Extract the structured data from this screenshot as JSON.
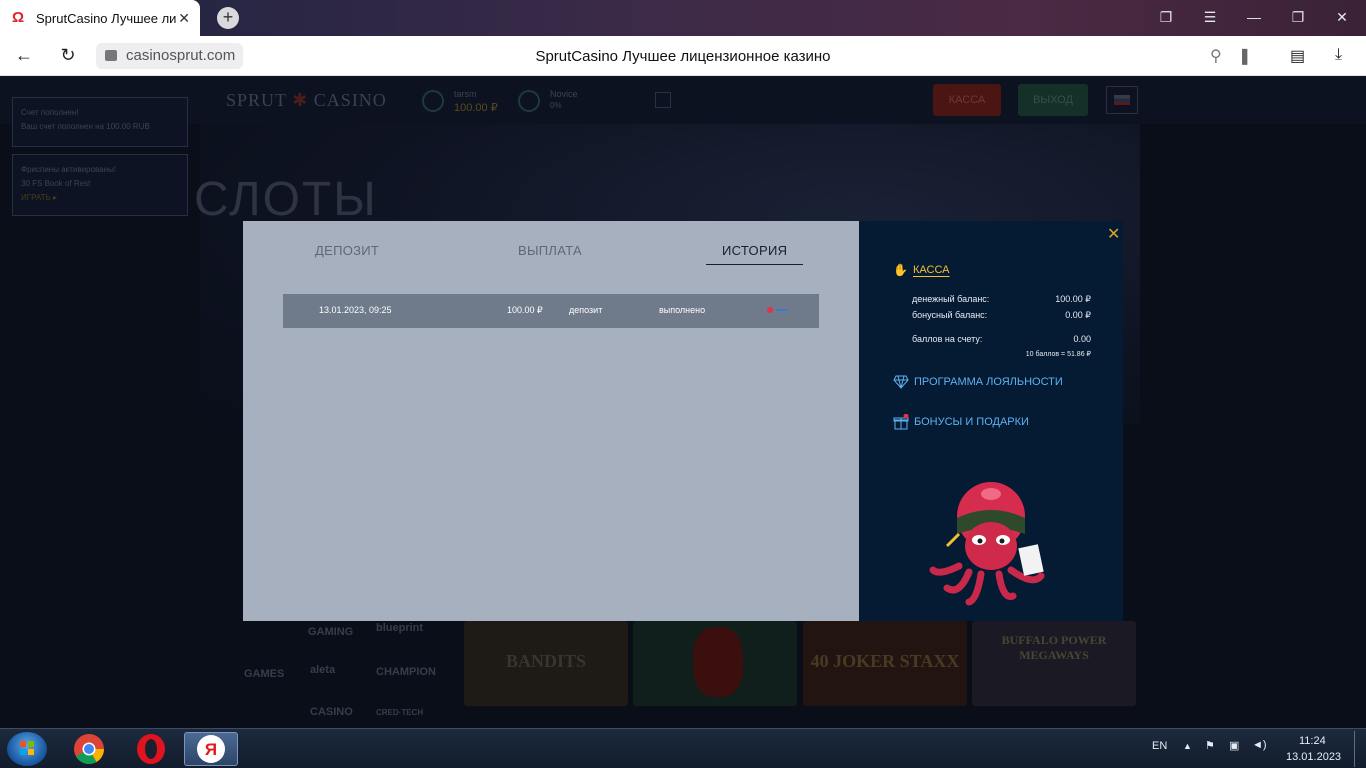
{
  "browser": {
    "tab_title": "SprutCasino Лучшее ли",
    "new_tab_symbol": "+",
    "url": "casinosprut.com",
    "page_title": "SprutCasino Лучшее лицензионное казино"
  },
  "site": {
    "logo_left": "SPRUT",
    "logo_right": "CASINO",
    "username": "tarsm",
    "balance": "100.00 ₽",
    "level": "Novice",
    "level_pct": "0%",
    "kassa_button": "КАССА",
    "exit_button": "ВЫХОД",
    "notifications": [
      {
        "title": "Счет пополнен!",
        "text": "Ваш счет пополнен на 100.00 RUB"
      },
      {
        "title": "Фриспины активированы!",
        "text": "30 FS Book of Rest",
        "link": "ИГРАТЬ ▸"
      }
    ],
    "section_title": "СЛОТЫ",
    "providers": [
      "GAMING",
      "blueprint",
      "GAMES",
      "aleta",
      "CHAMPION",
      "CASINO",
      "CRED·TECH"
    ],
    "games": [
      "BANDITS",
      "40 JOKER STAXX",
      "BUFFALO POWER MEGAWAYS"
    ]
  },
  "modal": {
    "tabs": [
      "ДЕПОЗИТ",
      "ВЫПЛАТА",
      "ИСТОРИЯ"
    ],
    "active_tab": "ИСТОРИЯ",
    "history": [
      {
        "date": "13.01.2023, 09:25",
        "amount": "100.00 ₽",
        "type": "депозит",
        "status": "выполнено"
      }
    ],
    "sidebar": {
      "kassa_label": "КАССА",
      "money_balance_label": "денежный баланс:",
      "money_balance_value": "100.00 ₽",
      "bonus_balance_label": "бонусный баланс:",
      "bonus_balance_value": "0.00 ₽",
      "points_label": "баллов на счету:",
      "points_value": "0.00",
      "points_rate": "10 баллов = 51.86 ₽",
      "loyalty_link": "ПРОГРАММА ЛОЯЛЬНОСТИ",
      "bonuses_link": "БОНУСЫ И ПОДАРКИ"
    },
    "accent_colors": {
      "gold": "#f2c12e",
      "blue_link": "#5eb2f2",
      "panel_dark": "#051a33",
      "panel_light": "#a7b0be"
    }
  },
  "taskbar": {
    "lang": "EN",
    "time": "11:24",
    "date": "13.01.2023"
  }
}
